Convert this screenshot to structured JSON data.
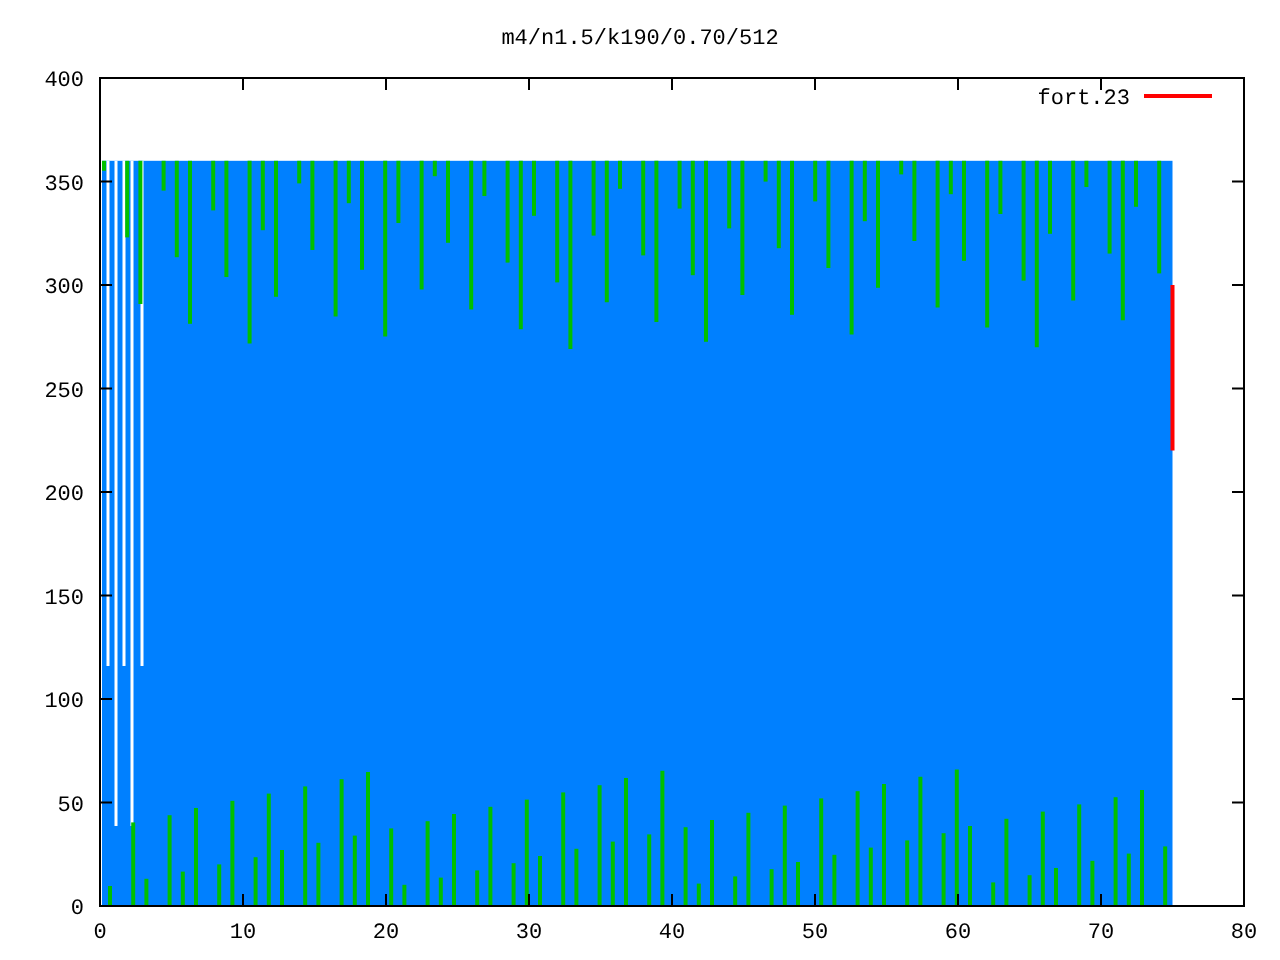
{
  "title": "m4/n1.5/k190/0.70/512",
  "legend": [
    {
      "label": "fort.23",
      "color": "#ff0000"
    }
  ],
  "xticks": [
    "0",
    "10",
    "20",
    "30",
    "40",
    "50",
    "60",
    "70",
    "80"
  ],
  "yticks": [
    "400",
    "350",
    "300",
    "250",
    "200",
    "150",
    "100",
    "50",
    "0"
  ]
}
